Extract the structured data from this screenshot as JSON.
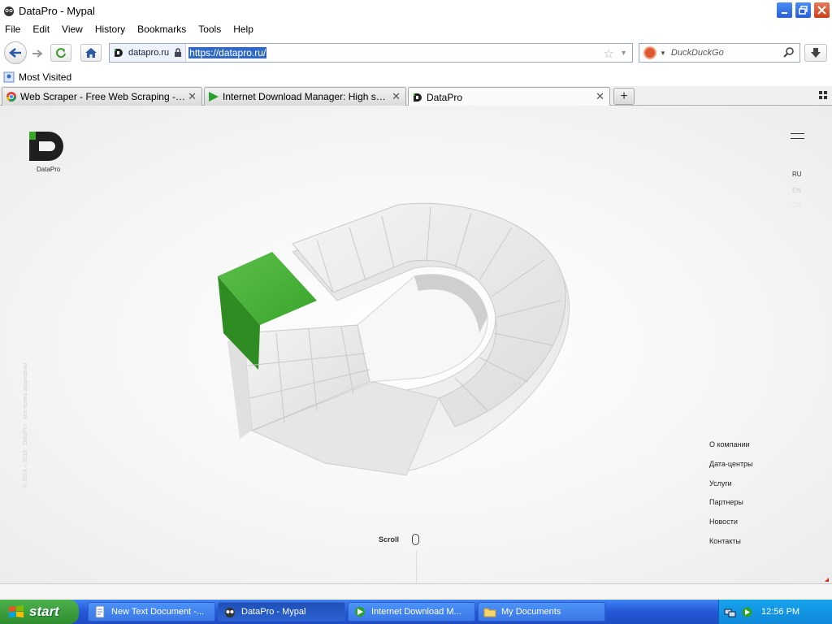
{
  "window": {
    "title": "DataPro - Mypal"
  },
  "menu": [
    "File",
    "Edit",
    "View",
    "History",
    "Bookmarks",
    "Tools",
    "Help"
  ],
  "urlbar": {
    "site": "datapro.ru",
    "url": "https://datapro.ru/"
  },
  "search": {
    "placeholder": "DuckDuckGo"
  },
  "bookmarks": {
    "most_visited": "Most Visited"
  },
  "tabs": [
    {
      "label": "Web Scraper - Free Web Scraping - Chro..."
    },
    {
      "label": "Internet Download Manager: High speed ..."
    },
    {
      "label": "DataPro"
    }
  ],
  "page": {
    "logo_text": "DataPro",
    "lang": [
      "RU",
      "EN",
      "CN"
    ],
    "nav": [
      "О компании",
      "Дата-центры",
      "Услуги",
      "Партнеры",
      "Новости",
      "Контакты"
    ],
    "scroll_label": "Scroll",
    "vertical_text": "© 2014 – 2018 · DataPro · все права защищены"
  },
  "taskbar": {
    "start": "start",
    "tasks": [
      {
        "label": "New Text Document -..."
      },
      {
        "label": "DataPro - Mypal"
      },
      {
        "label": "Internet Download M..."
      },
      {
        "label": "My Documents"
      }
    ],
    "clock": "12:56 PM"
  },
  "colors": {
    "accent_green": "#3aa52b",
    "selection": "#316ac5",
    "xp_blue": "#2456d6"
  }
}
